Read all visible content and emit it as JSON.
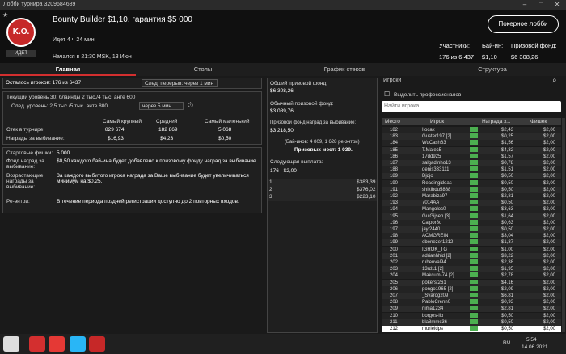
{
  "window": {
    "title": "Лобби турнира 3209684689",
    "minimize": "–",
    "maximize": "□",
    "close": "✕"
  },
  "header": {
    "tournament": "Bounty Builder $1,10, гарантия $5 000",
    "elapsed": "Идет 4 ч 24 мин",
    "started": "Начался в 21:30 MSK, 13 Июн",
    "status": "ИДЕТ",
    "logo_text": "K.O.",
    "lobby_button": "Покерное лобби",
    "stats": {
      "players_label": "Участники:",
      "buyin_label": "Бай-ин:",
      "prize_label": "Призовой фонд:",
      "players": "176 из 6 437",
      "buyin": "$1,10",
      "prize": "$6 308,26"
    }
  },
  "tabs": [
    "Главная",
    "Столы",
    "График стеков",
    "Структура"
  ],
  "main": {
    "remaining": "Осталось игроков: 176 из 6437",
    "break": "След. перерыв: через 1 мин",
    "cur_level": "Текущий уровень 30:  блайнды 2 тыс./4 тыс. анте 600",
    "next_level": "След. уровень:  2,5 тыс./5 тыс. анте 800",
    "next_level_time": "через 5 мин",
    "stack_headers": [
      "Самый крупный",
      "Средний",
      "Самый маленький"
    ],
    "stack_label": "Стек в турнире:",
    "stacks": [
      "829 674",
      "182 869",
      "5 068"
    ],
    "bounty_label": "Награды за выбивание:",
    "bounties": [
      "$16,93",
      "$4,23",
      "$0,50"
    ],
    "start_chips_label": "Стартовые фишки:",
    "start_chips": "5 000",
    "bounty_fund_label": "Фонд наград за выбивание:",
    "bounty_fund_text": "$0,50 каждого бай-ина будет добавлено к призовому фонду наград за выбивание.",
    "progressive_label": "Возрастающие награды за выбивание:",
    "progressive_text": "За каждого выбитого игрока награда за Ваше выбивание будет увеличиваться минимум на $0,25.",
    "reentry_label": "Ре-энтри:",
    "reentry_text": "В течение периода поздней регистрации доступно до 2 повторных входов."
  },
  "prizes": {
    "total_label": "Общий призовой фонд:",
    "total": "$6 308,26",
    "regular_label": "Обычный призовой фонд:",
    "regular": "$3 089,76",
    "bounty_label": "Призовой фонд наград за выбивание:",
    "bounty": "$3 218,50",
    "entries": "(Бай-инов: 4 809, 1 628 ре-энтри)",
    "paid": "Призовых мест: 1 039.",
    "next_label": "Следующая выплата:",
    "next_range": "176 - $2,00",
    "payouts": [
      {
        "place": "1",
        "amount": "$383,39"
      },
      {
        "place": "2",
        "amount": "$376,02"
      },
      {
        "place": "3",
        "amount": "$223,10"
      }
    ]
  },
  "players": {
    "header": "Игроки",
    "pro_checkbox": "Выделить профессионалов",
    "search_placeholder": "Найти игрока",
    "cols": [
      "Место",
      "Игрок",
      "Награда з...",
      "Фишек"
    ],
    "rows": [
      [
        "182",
        "Ilocax",
        "$2,43",
        "$2,00"
      ],
      [
        "183",
        "Guster197 [2]",
        "$0,25",
        "$2,00"
      ],
      [
        "184",
        "WuCash63",
        "$1,56",
        "$2,00"
      ],
      [
        "185",
        "T.Malec5",
        "$4,32",
        "$2,00"
      ],
      [
        "186",
        "17dd925",
        "$1,57",
        "$2,00"
      ],
      [
        "187",
        "salgadinho13",
        "$0,78",
        "$2,00"
      ],
      [
        "188",
        "denis333111",
        "$1,51",
        "$2,00"
      ],
      [
        "189",
        "Djdjo",
        "$0,50",
        "$2,00"
      ],
      [
        "190",
        "Readingideas",
        "$0,50",
        "$2,00"
      ],
      [
        "191",
        "shikibdu5888",
        "$0,50",
        "$2,00"
      ],
      [
        "192",
        "Marabiza97",
        "$2,81",
        "$2,00"
      ],
      [
        "193",
        "7014AA",
        "$0,50",
        "$2,00"
      ],
      [
        "194",
        "Mangoloc0",
        "$3,63",
        "$2,00"
      ],
      [
        "195",
        "GuiGijsen [3]",
        "$1,64",
        "$2,00"
      ],
      [
        "196",
        "Caipor8o",
        "$0,63",
        "$2,00"
      ],
      [
        "197",
        "jayl2440",
        "$0,50",
        "$2,00"
      ],
      [
        "198",
        "ACMGREIN",
        "$3,04",
        "$2,00"
      ],
      [
        "199",
        "ebenezer1212",
        "$1,37",
        "$2,00"
      ],
      [
        "200",
        "IGROK_TG",
        "$1,00",
        "$2,00"
      ],
      [
        "201",
        "adrianhhid [2]",
        "$3,22",
        "$2,00"
      ],
      [
        "202",
        "rubenval94",
        "$2,38",
        "$2,00"
      ],
      [
        "203",
        "13rd11 [2]",
        "$1,95",
        "$2,00"
      ],
      [
        "204",
        "Makcum-74 [2]",
        "$2,78",
        "$2,00"
      ],
      [
        "205",
        "pokerst261",
        "$4,16",
        "$2,00"
      ],
      [
        "206",
        "pongo1965 [2]",
        "$2,09",
        "$2,00"
      ],
      [
        "207",
        "_Svarog209",
        "$6,81",
        "$2,00"
      ],
      [
        "208",
        "PabloCrenn0",
        "$0,93",
        "$2,00"
      ],
      [
        "209",
        "rlima1234",
        "$2,81",
        "$2,00"
      ],
      [
        "210",
        "borges-lib",
        "$0,50",
        "$2,00"
      ],
      [
        "211",
        "bla8mmc36",
        "$0,50",
        "$2,00"
      ],
      [
        "212",
        "murieldps",
        "$0,50",
        "$2,00"
      ]
    ]
  },
  "taskbar": {
    "lang": "RU",
    "time": "5:54",
    "date": "14.06.2021"
  }
}
